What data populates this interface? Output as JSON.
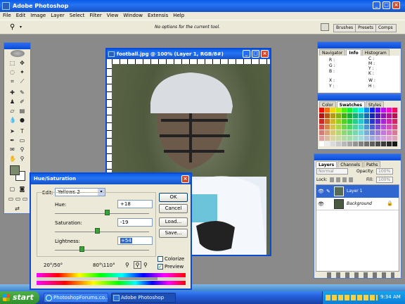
{
  "app": {
    "title": "Adobe Photoshop"
  },
  "menu": [
    "File",
    "Edit",
    "Image",
    "Layer",
    "Select",
    "Filter",
    "View",
    "Window",
    "Extensis",
    "Help"
  ],
  "options": {
    "message": "No options for the current tool."
  },
  "well_tabs": [
    "Brushes",
    "Presets",
    "Comps"
  ],
  "document": {
    "title": "football.jpg @ 100% (Layer 1, RGB/8#)"
  },
  "navigator": {
    "tabs": [
      "Navigator",
      "Info",
      "Histogram"
    ],
    "info_left": "R :\nG :\nB :",
    "info_right": "C :\nM :\nY :\nK :",
    "xy_left": "X :\nY :",
    "wh_right": "W :\nH :"
  },
  "color_palette": {
    "tabs": [
      "Color",
      "Swatches",
      "Styles"
    ]
  },
  "layers_palette": {
    "tabs": [
      "Layers",
      "Channels",
      "Paths"
    ],
    "blend_mode": "Normal",
    "opacity_label": "Opacity:",
    "opacity": "100%",
    "lock_label": "Lock:",
    "fill_label": "Fill:",
    "fill": "100%",
    "layers": [
      {
        "name": "Layer 1",
        "selected": true
      },
      {
        "name": "Background",
        "selected": false
      }
    ]
  },
  "hue_dialog": {
    "title": "Hue/Saturation",
    "edit_label": "Edit:",
    "edit_value": "Yellows 2",
    "hue_label": "Hue:",
    "hue": "+18",
    "hue_frac": 0.55,
    "sat_label": "Saturation:",
    "sat": "-19",
    "sat_frac": 0.45,
    "light_label": "Lightness:",
    "light": "+54",
    "light_frac": 0.28,
    "ok": "OK",
    "cancel": "Cancel",
    "load": "Load...",
    "save": "Save...",
    "colorize": "Colorize",
    "preview": "Preview",
    "range_left": "20°/50°",
    "range_right": "80°\\110°"
  },
  "taskbar": {
    "start": "start",
    "items": [
      "PhotoshopForums.co...",
      "Adobe Photoshop"
    ],
    "clock": "9:34 AM"
  }
}
